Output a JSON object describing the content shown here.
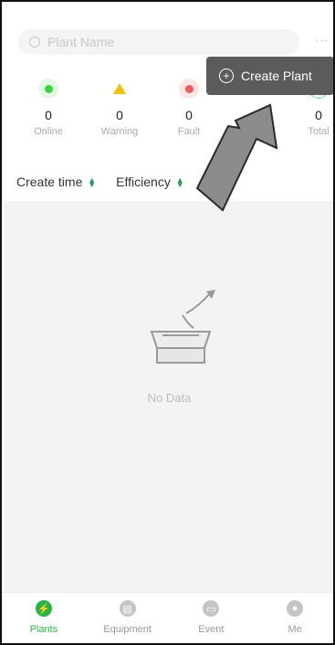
{
  "search": {
    "placeholder": "Plant Name",
    "more": "···"
  },
  "stats": [
    {
      "count": "0",
      "label": "Online",
      "color": "#3dd13d"
    },
    {
      "count": "0",
      "label": "Warning",
      "color": "#f2c200"
    },
    {
      "count": "0",
      "label": "Fault",
      "color": "#f15a5a"
    },
    {
      "count": "0",
      "label": "Total",
      "color": "#5fd8b0"
    }
  ],
  "sort": {
    "create_time": "Create time",
    "efficiency": "Efficiency"
  },
  "empty": {
    "text": "No Data"
  },
  "popup": {
    "create_plant": "Create Plant"
  },
  "tabs": [
    {
      "label": "Plants",
      "icon": "bolt-icon"
    },
    {
      "label": "Equipment",
      "icon": "equipment-icon"
    },
    {
      "label": "Event",
      "icon": "event-icon"
    },
    {
      "label": "Me",
      "icon": "user-icon"
    }
  ]
}
